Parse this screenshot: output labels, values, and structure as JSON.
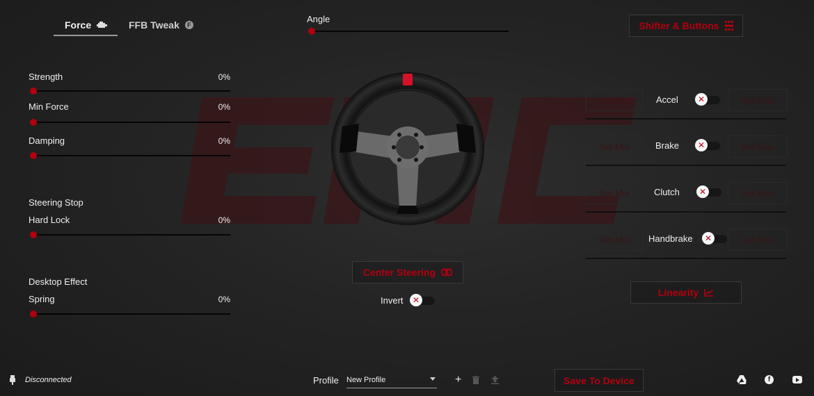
{
  "tabs": [
    {
      "label": "Force",
      "icon": "engine-icon",
      "active": true
    },
    {
      "label": "FFB Tweak",
      "icon": "f-circle-icon",
      "active": false
    }
  ],
  "angle": {
    "label": "Angle",
    "value": 0
  },
  "shifter_button": {
    "label": "Shifter & Buttons",
    "icon": "gear-shift-grid-icon"
  },
  "force": {
    "strength": {
      "label": "Strength",
      "value": "0%"
    },
    "min_force": {
      "label": "Min Force",
      "value": "0%"
    },
    "damping": {
      "label": "Damping",
      "value": "0%"
    }
  },
  "steering_stop": {
    "section": "Steering Stop",
    "hard_lock": {
      "label": "Hard Lock",
      "value": "0%"
    }
  },
  "desktop_effect": {
    "section": "Desktop Effect",
    "spring": {
      "label": "Spring",
      "value": "0%"
    }
  },
  "center_steering": {
    "label": "Center Steering",
    "icon": "center-icon"
  },
  "invert": {
    "label": "Invert",
    "enabled": false
  },
  "pedals": {
    "set_min": "Set Min",
    "set_max": "Set Max",
    "items": [
      {
        "label": "Accel",
        "enabled": false
      },
      {
        "label": "Brake",
        "enabled": false
      },
      {
        "label": "Clutch",
        "enabled": false
      },
      {
        "label": "Handbrake",
        "enabled": false
      }
    ]
  },
  "linearity": {
    "label": "Linearity",
    "icon": "chart-line-icon"
  },
  "footer": {
    "status": "Disconnected",
    "profile_label": "Profile",
    "profile_value": "New Profile",
    "save_label": "Save To Device"
  },
  "colors": {
    "accent": "#b3000f",
    "knob": "#b10010",
    "background": "#242424"
  },
  "watermark": "EMC"
}
